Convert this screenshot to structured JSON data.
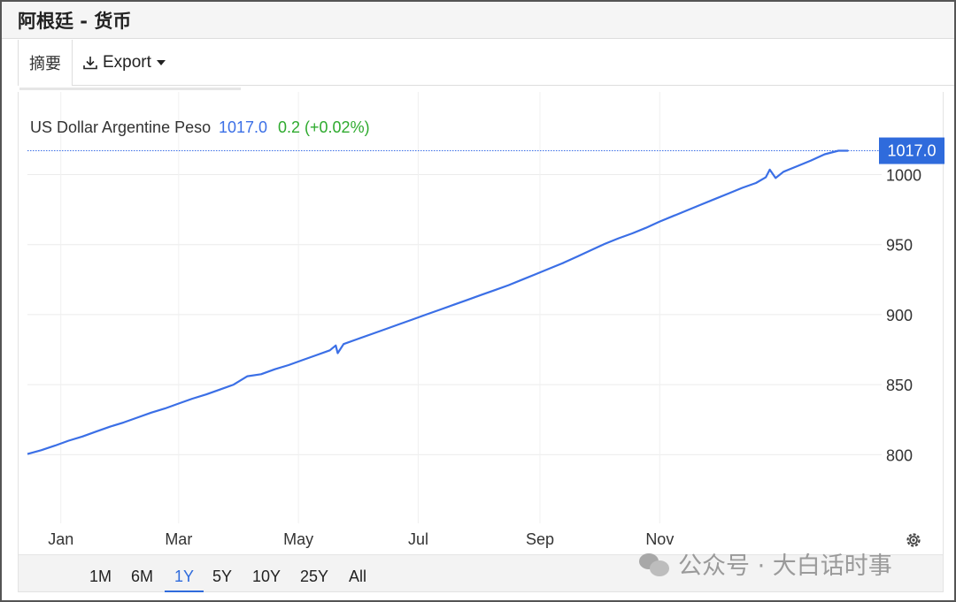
{
  "header": {
    "title": "阿根廷 - 货币"
  },
  "tabs": {
    "summary_label": "摘要",
    "export_label": "Export"
  },
  "legend": {
    "series_name": "US Dollar Argentine Peso",
    "last_value": "1017.0",
    "change": "0.2 (+0.02%)"
  },
  "price_tag": "1017.0",
  "ranges": [
    "1M",
    "6M",
    "1Y",
    "5Y",
    "10Y",
    "25Y",
    "All"
  ],
  "active_range": "1Y",
  "watermark": "公众号 · 大白话时事",
  "colors": {
    "line": "#3b6fe6",
    "change_positive": "#2eaa2e",
    "price_tag_bg": "#2f6bdc"
  },
  "icons": {
    "export": "download-icon",
    "settings": "gear-icon",
    "watermark": "wechat-icon"
  },
  "chart_data": {
    "type": "line",
    "series": [
      {
        "name": "US Dollar Argentine Peso",
        "points": [
          [
            "2023-12-29",
            800.5
          ],
          [
            "2024-01-05",
            803.2
          ],
          [
            "2024-01-12",
            806.5
          ],
          [
            "2024-01-19",
            810.0
          ],
          [
            "2024-01-26",
            813.0
          ],
          [
            "2024-02-02",
            816.5
          ],
          [
            "2024-02-09",
            820.0
          ],
          [
            "2024-02-16",
            823.0
          ],
          [
            "2024-02-23",
            826.5
          ],
          [
            "2024-03-01",
            830.0
          ],
          [
            "2024-03-08",
            833.0
          ],
          [
            "2024-03-15",
            836.5
          ],
          [
            "2024-03-22",
            840.0
          ],
          [
            "2024-03-29",
            843.0
          ],
          [
            "2024-04-05",
            846.5
          ],
          [
            "2024-04-12",
            850.0
          ],
          [
            "2024-04-19",
            856.0
          ],
          [
            "2024-04-26",
            857.5
          ],
          [
            "2024-05-03",
            861.0
          ],
          [
            "2024-05-10",
            864.0
          ],
          [
            "2024-05-17",
            867.5
          ],
          [
            "2024-05-24",
            871.0
          ],
          [
            "2024-05-31",
            874.5
          ],
          [
            "2024-06-03",
            878.0
          ],
          [
            "2024-06-04",
            872.5
          ],
          [
            "2024-06-07",
            879.0
          ],
          [
            "2024-06-14",
            882.5
          ],
          [
            "2024-06-21",
            886.0
          ],
          [
            "2024-06-28",
            889.5
          ],
          [
            "2024-07-05",
            893.0
          ],
          [
            "2024-07-12",
            896.5
          ],
          [
            "2024-07-19",
            900.0
          ],
          [
            "2024-07-26",
            903.5
          ],
          [
            "2024-08-02",
            907.0
          ],
          [
            "2024-08-09",
            910.5
          ],
          [
            "2024-08-16",
            914.0
          ],
          [
            "2024-08-23",
            917.5
          ],
          [
            "2024-08-30",
            921.0
          ],
          [
            "2024-09-06",
            925.0
          ],
          [
            "2024-09-13",
            929.0
          ],
          [
            "2024-09-20",
            933.0
          ],
          [
            "2024-09-27",
            937.0
          ],
          [
            "2024-10-04",
            941.5
          ],
          [
            "2024-10-11",
            946.0
          ],
          [
            "2024-10-18",
            950.5
          ],
          [
            "2024-10-25",
            954.5
          ],
          [
            "2024-11-01",
            958.0
          ],
          [
            "2024-11-08",
            962.0
          ],
          [
            "2024-11-15",
            966.5
          ],
          [
            "2024-11-22",
            970.5
          ],
          [
            "2024-11-29",
            974.5
          ],
          [
            "2024-12-06",
            978.5
          ],
          [
            "2024-12-13",
            982.5
          ],
          [
            "2024-12-20",
            986.5
          ],
          [
            "2024-12-27",
            990.5
          ],
          [
            "2025-01-03",
            994.0
          ],
          [
            "2025-01-08",
            998.0
          ],
          [
            "2025-01-10",
            1003.5
          ],
          [
            "2025-01-13",
            997.5
          ],
          [
            "2025-01-17",
            1002.0
          ],
          [
            "2025-01-24",
            1006.0
          ],
          [
            "2025-01-31",
            1010.0
          ],
          [
            "2025-02-07",
            1014.5
          ],
          [
            "2025-02-14",
            1017.0
          ],
          [
            "2025-02-19",
            1017.0
          ]
        ]
      }
    ],
    "xaxis": {
      "ticks": [
        [
          "Jan",
          "2024-01-15"
        ],
        [
          "Mar",
          "2024-03-15"
        ],
        [
          "May",
          "2024-05-15"
        ],
        [
          "Jul",
          "2024-07-15"
        ],
        [
          "Sep",
          "2024-09-15"
        ],
        [
          "Nov",
          "2024-11-15"
        ]
      ],
      "range": [
        "2023-12-29",
        "2025-03-08"
      ]
    },
    "yaxis": {
      "ticks": [
        800,
        850,
        900,
        950,
        1000
      ],
      "range": [
        751,
        1059
      ],
      "side": "right"
    },
    "grid": true,
    "last_value_line": 1017.0
  }
}
